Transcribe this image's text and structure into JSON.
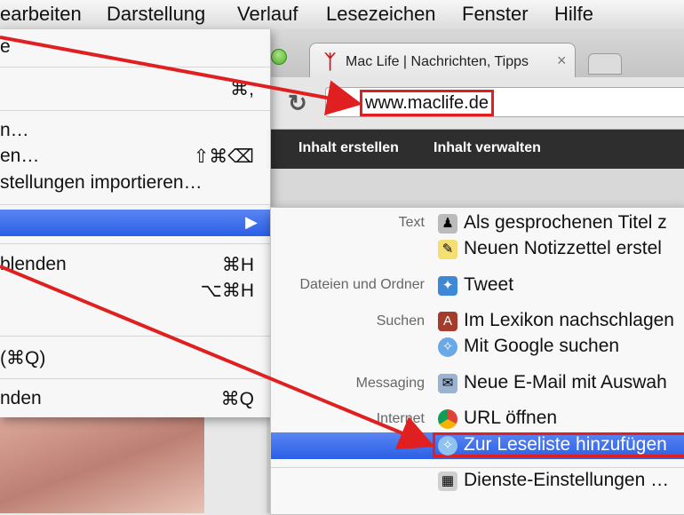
{
  "menubar": {
    "items": [
      "earbeiten",
      "Darstellung",
      "Verlauf",
      "Lesezeichen",
      "Fenster",
      "Hilfe"
    ]
  },
  "browser": {
    "tab_title": "Mac Life | Nachrichten, Tipps",
    "tab_close": "×",
    "url": "www.maclife.de",
    "reload_icon": "↻",
    "site_nav": [
      "Inhalt erstellen",
      "Inhalt verwalten"
    ]
  },
  "app_menu": {
    "items": [
      {
        "label": "e",
        "shortcut": ""
      },
      {
        "label": "",
        "shortcut": "⌘,"
      },
      {
        "label": "n…",
        "shortcut": ""
      },
      {
        "label": "en…",
        "shortcut": "⇧⌘⌫"
      },
      {
        "label": "stellungen importieren…",
        "shortcut": ""
      },
      {
        "label": "",
        "shortcut": ""
      },
      {
        "label": "blenden",
        "shortcut": "⌘H"
      },
      {
        "label": "",
        "shortcut": "⌥⌘H"
      },
      {
        "label": "(⌘Q)",
        "shortcut": ""
      },
      {
        "label": "nden",
        "shortcut": "⌘Q"
      }
    ],
    "submenu_arrow": "▶"
  },
  "services": {
    "categories": [
      "Text",
      "Dateien und Ordner",
      "Suchen",
      "Messaging",
      "Internet"
    ],
    "items": [
      {
        "label": "Als gesprochenen Titel z",
        "icon": "speech-icon"
      },
      {
        "label": "Neuen Notizzettel erstel",
        "icon": "stickies-icon"
      },
      {
        "label": "Tweet",
        "icon": "twitter-icon"
      },
      {
        "label": "Im Lexikon nachschlagen",
        "icon": "dictionary-icon"
      },
      {
        "label": "Mit Google suchen",
        "icon": "safari-icon"
      },
      {
        "label": "Neue E-Mail mit Auswah",
        "icon": "mail-icon"
      },
      {
        "label": "URL öffnen",
        "icon": "chrome-icon"
      },
      {
        "label": "Zur Leseliste hinzufügen",
        "icon": "safari-icon"
      },
      {
        "label": "Dienste-Einstellungen …",
        "icon": "settings-icon"
      }
    ]
  },
  "colors": {
    "highlight": "#2a5fe6",
    "annotation": "#e02020"
  }
}
